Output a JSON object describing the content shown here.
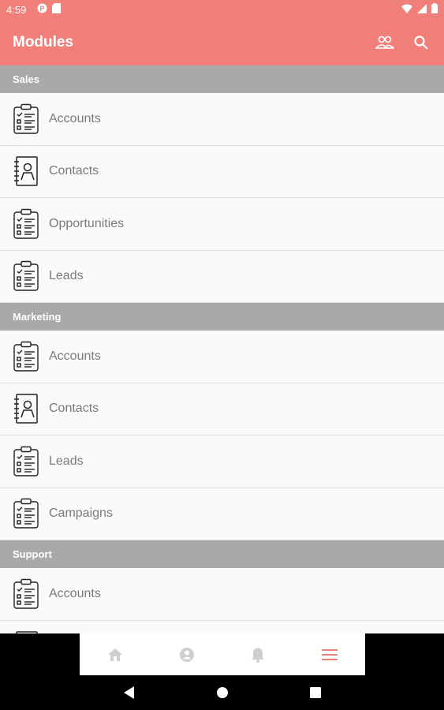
{
  "status_bar": {
    "time": "4:59"
  },
  "app_bar": {
    "title": "Modules",
    "actions": [
      "people-icon",
      "search-icon"
    ]
  },
  "sections": [
    {
      "title": "Sales",
      "items": [
        {
          "label": "Accounts",
          "icon": "clipboard-checklist-icon"
        },
        {
          "label": "Contacts",
          "icon": "contact-book-icon"
        },
        {
          "label": "Opportunities",
          "icon": "clipboard-checklist-icon"
        },
        {
          "label": "Leads",
          "icon": "clipboard-checklist-icon"
        }
      ]
    },
    {
      "title": "Marketing",
      "items": [
        {
          "label": "Accounts",
          "icon": "clipboard-checklist-icon"
        },
        {
          "label": "Contacts",
          "icon": "contact-book-icon"
        },
        {
          "label": "Leads",
          "icon": "clipboard-checklist-icon"
        },
        {
          "label": "Campaigns",
          "icon": "clipboard-checklist-icon"
        }
      ]
    },
    {
      "title": "Support",
      "items": [
        {
          "label": "Accounts",
          "icon": "clipboard-checklist-icon"
        },
        {
          "label": "",
          "icon": "contact-book-icon"
        }
      ]
    }
  ],
  "bottom_nav": [
    "home-icon",
    "account-icon",
    "bell-icon",
    "menu-icon"
  ],
  "colors": {
    "accent": "#f07f79",
    "section_header": "#a9a9a9",
    "inactive_nav": "#cfcfcf"
  }
}
